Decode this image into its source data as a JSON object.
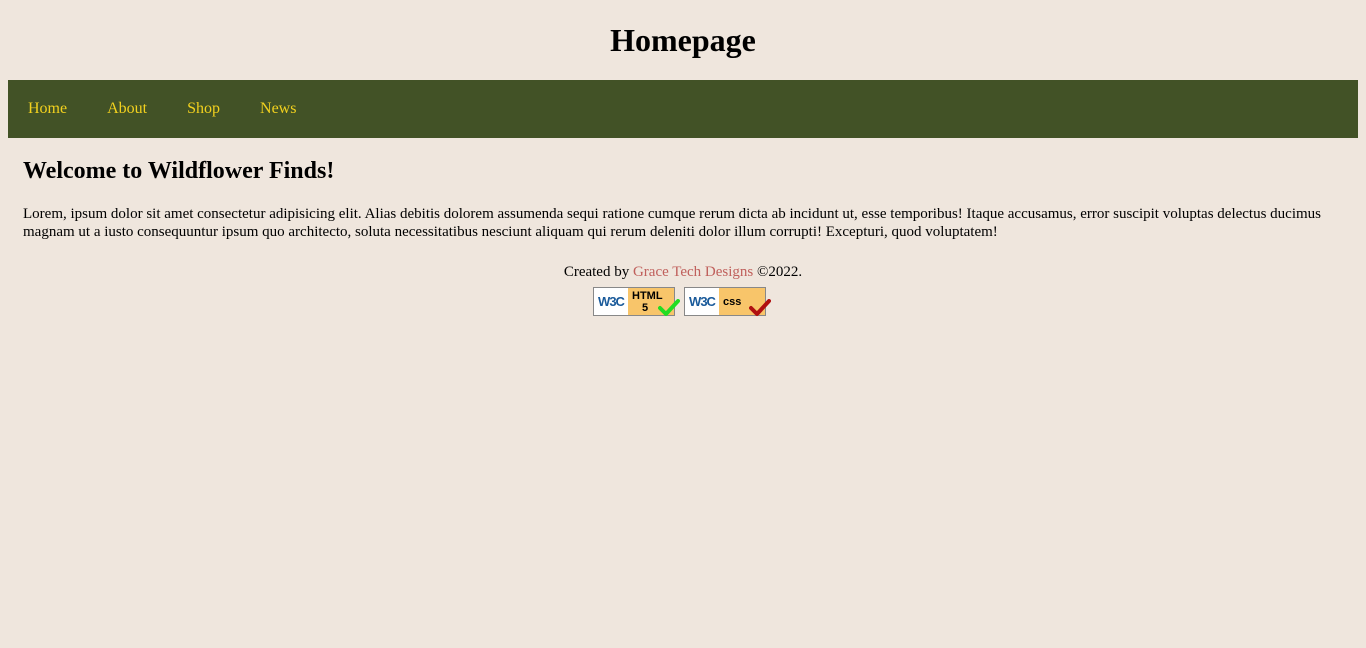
{
  "header": {
    "title": "Homepage"
  },
  "nav": {
    "items": [
      {
        "label": "Home"
      },
      {
        "label": "About"
      },
      {
        "label": "Shop"
      },
      {
        "label": "News"
      }
    ]
  },
  "main": {
    "heading": "Welcome to Wildflower Finds!",
    "paragraph": "Lorem, ipsum dolor sit amet consectetur adipisicing elit. Alias debitis dolorem assumenda sequi ratione cumque rerum dicta ab incidunt ut, esse temporibus! Itaque accusamus, error suscipit voluptas delectus ducimus magnam ut a iusto consequuntur ipsum quo architecto, soluta necessitatibus nesciunt aliquam qui rerum deleniti dolor illum corrupti! Excepturi, quod voluptatem!"
  },
  "footer": {
    "prefix": "Created by ",
    "link_text": "Grace Tech Designs",
    "suffix": " ©2022."
  },
  "badges": {
    "html": {
      "w3c": "W3C",
      "line1": "HTML",
      "line2": "5",
      "check_color": "#22dd22"
    },
    "css": {
      "w3c": "W3C",
      "line1": "css",
      "check_color": "#b01010"
    }
  },
  "colors": {
    "background": "#efe6dd",
    "nav_background": "#425226",
    "nav_link": "#f2d11e",
    "footer_link": "#c0605c"
  }
}
